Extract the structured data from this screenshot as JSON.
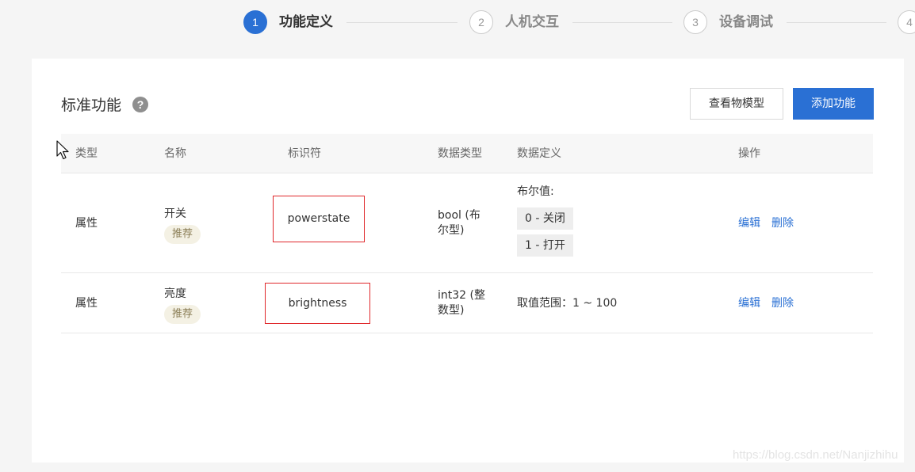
{
  "steps": [
    {
      "number": "1",
      "label": "功能定义",
      "active": true
    },
    {
      "number": "2",
      "label": "人机交互",
      "active": false
    },
    {
      "number": "3",
      "label": "设备调试",
      "active": false
    },
    {
      "number": "4",
      "label": "",
      "active": false
    }
  ],
  "section": {
    "title": "标准功能",
    "help_icon": "?",
    "view_model_button": "查看物模型",
    "add_function_button": "添加功能"
  },
  "table": {
    "columns": [
      "类型",
      "名称",
      "标识符",
      "数据类型",
      "数据定义",
      "操作"
    ],
    "rows": [
      {
        "type": "属性",
        "name": "开关",
        "tag": "推荐",
        "identifier": "powerstate",
        "data_type_line1": "bool (布",
        "data_type_line2": "尔型)",
        "definition_title": "布尔值:",
        "definition_values": [
          "0 - 关闭",
          "1 - 打开"
        ],
        "actions": [
          "编辑",
          "删除"
        ]
      },
      {
        "type": "属性",
        "name": "亮度",
        "tag": "推荐",
        "identifier": "brightness",
        "data_type_line1": "int32 (整",
        "data_type_line2": "数型)",
        "definition_text": "取值范围：1 ~ 100",
        "actions": [
          "编辑",
          "删除"
        ]
      }
    ]
  },
  "watermark": "https://blog.csdn.net/Nanjizhihu",
  "colors": {
    "primary": "#2a70d4",
    "highlight_border": "#e0282b",
    "tag_bg": "#f4f1e4",
    "page_bg": "#f5f5f5"
  }
}
